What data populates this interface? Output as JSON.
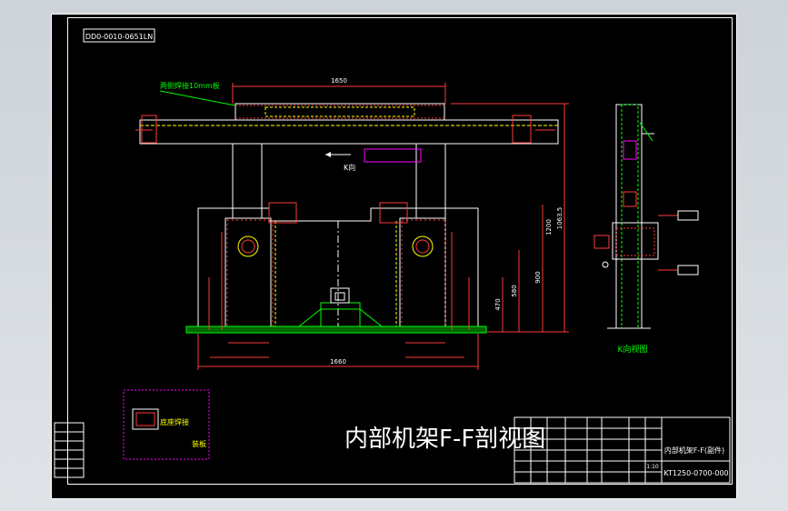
{
  "drawing": {
    "code_box": "DD0-0010-0651LN",
    "title": "内部机架F-F剖视图",
    "side_view_label": "K向视图",
    "arrow_label": "K向",
    "note_top": "两侧焊接10mm板",
    "note_bottom": "底座焊接",
    "note_bottom_2": "装板"
  },
  "title_block": {
    "part_name": "内部机架F-F(副件)",
    "drawing_number": "KT1250-0700-000",
    "scale": "1:10"
  },
  "dimensions": {
    "overall_width": "1660",
    "top_width": "1650",
    "height_1": "1063.5",
    "height_2": "1200",
    "height_3": "900",
    "height_4": "580",
    "height_5": "470"
  },
  "colors": {
    "background": "#000000",
    "frame": "#ffffff",
    "structure": "#ffffff",
    "dimension": "#ff3a3a",
    "hidden": "#ffff00",
    "weld": "#00ff00",
    "highlight": "#ff00ff",
    "note": "#00ff00"
  }
}
